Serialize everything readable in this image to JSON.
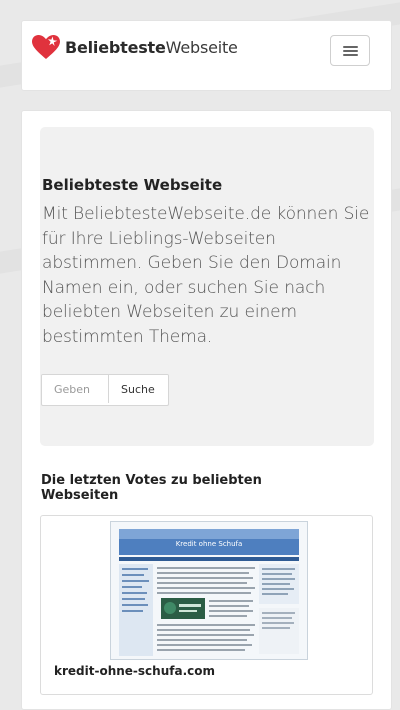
{
  "brand": {
    "bold": "Beliebteste",
    "light": "Webseite"
  },
  "hero": {
    "title": "Beliebteste Webseite",
    "text": "Mit BeliebtesteWebseite.de können Sie für Ihre Lieblings-Webseiten abstimmen. Geben Sie den Domain Namen ein, oder suchen Sie nach beliebten Webseiten zu einem bestimmten Thema.",
    "input_placeholder": "Geben",
    "search_label": "Suche"
  },
  "votes": {
    "title": "Die letzten Votes zu beliebten Webseiten",
    "items": [
      {
        "site": "kredit-ohne-schufa.com",
        "thumb_title": "Kredit ohne Schufa"
      }
    ]
  },
  "colors": {
    "brand_red": "#e0323d",
    "hero_bg": "#f1f1f1"
  }
}
